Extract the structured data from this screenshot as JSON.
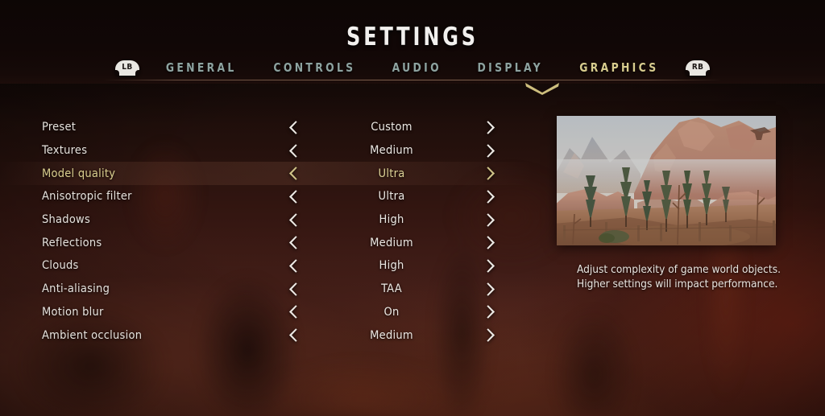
{
  "header": {
    "title": "SETTINGS",
    "bumper_left": "LB",
    "bumper_right": "RB",
    "accent_color": "#d8cc8e",
    "inactive_tab_color": "#8ea3a0",
    "tabs": [
      {
        "label": "GENERAL",
        "active": false
      },
      {
        "label": "CONTROLS",
        "active": false
      },
      {
        "label": "AUDIO",
        "active": false
      },
      {
        "label": "DISPLAY",
        "active": false
      },
      {
        "label": "GRAPHICS",
        "active": true
      }
    ]
  },
  "settings": {
    "rows": [
      {
        "label": "Preset",
        "value": "Custom",
        "selected": false
      },
      {
        "label": "Textures",
        "value": "Medium",
        "selected": false
      },
      {
        "label": "Model quality",
        "value": "Ultra",
        "selected": true
      },
      {
        "label": "Anisotropic filter",
        "value": "Ultra",
        "selected": false
      },
      {
        "label": "Shadows",
        "value": "High",
        "selected": false
      },
      {
        "label": "Reflections",
        "value": "Medium",
        "selected": false
      },
      {
        "label": "Clouds",
        "value": "High",
        "selected": false
      },
      {
        "label": "Anti-aliasing",
        "value": "TAA",
        "selected": false
      },
      {
        "label": "Motion blur",
        "value": "On",
        "selected": false
      },
      {
        "label": "Ambient occlusion",
        "value": "Medium",
        "selected": false
      }
    ]
  },
  "preview": {
    "description": "Adjust complexity of game world objects. Higher settings will impact performance.",
    "image_alt": "mountain valley with pine trees and rocky cliffs"
  }
}
